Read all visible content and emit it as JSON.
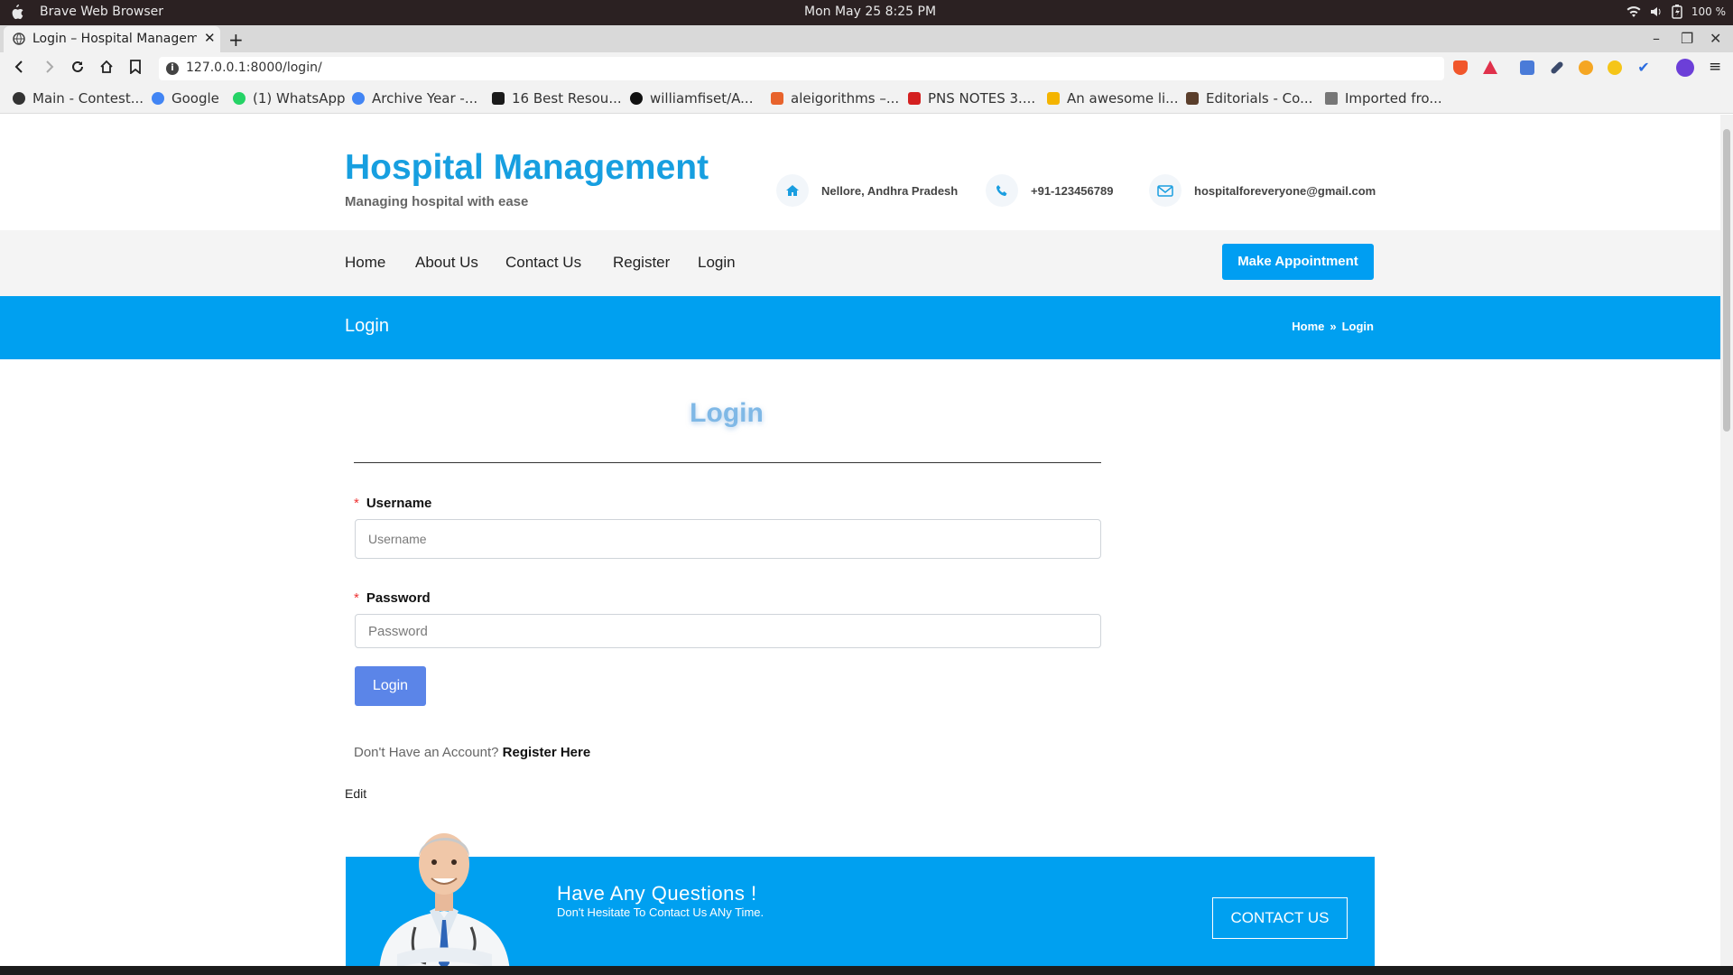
{
  "os": {
    "app_name": "Brave Web Browser",
    "clock": "Mon May 25   8:25 PM",
    "battery": "100 %"
  },
  "browser": {
    "tab_title": "Login – Hospital Management",
    "url": "127.0.0.1:8000/login/",
    "bookmarks": [
      {
        "label": "Main - Contest...",
        "color": "#333333"
      },
      {
        "label": "Google",
        "color": "#4285f4"
      },
      {
        "label": "(1) WhatsApp",
        "color": "#25d366"
      },
      {
        "label": "Archive Year -...",
        "color": "#4285f4"
      },
      {
        "label": "16 Best Resou...",
        "color": "#1a1a1a"
      },
      {
        "label": "williamfiset/A...",
        "color": "#111111"
      },
      {
        "label": "aleigorithms –...",
        "color": "#e8632c"
      },
      {
        "label": "PNS NOTES 3....",
        "color": "#d42020"
      },
      {
        "label": "An awesome li...",
        "color": "#f4b400"
      },
      {
        "label": "Editorials - Co...",
        "color": "#5a3e2b"
      },
      {
        "label": "Imported fro...",
        "color": "#777777"
      }
    ]
  },
  "site": {
    "title": "Hospital Management",
    "tagline": "Managing hospital with ease",
    "location": "Nellore, Andhra Pradesh",
    "phone": "+91-123456789",
    "email": "hospitalforeveryone@gmail.com",
    "menu": [
      "Home",
      "About Us",
      "Contact Us",
      "Register",
      "Login"
    ],
    "appointment_button": "Make Appointment",
    "banner_title": "Login",
    "breadcrumb": {
      "home": "Home",
      "separator": "»",
      "current": "Login"
    },
    "accent_color": "#00a0f0"
  },
  "login_form": {
    "heading": "Login",
    "required_mark": "*",
    "username_label": "Username",
    "username_placeholder": "Username",
    "password_label": "Password",
    "password_placeholder": "Password",
    "submit_label": "Login",
    "no_account_text": "Don't Have an Account?",
    "register_link": "Register Here",
    "edit_link": "Edit"
  },
  "cta": {
    "title": "Have Any Questions !",
    "subtitle": "Don't Hesitate To Contact Us ANy Time.",
    "button": "CONTACT US"
  }
}
